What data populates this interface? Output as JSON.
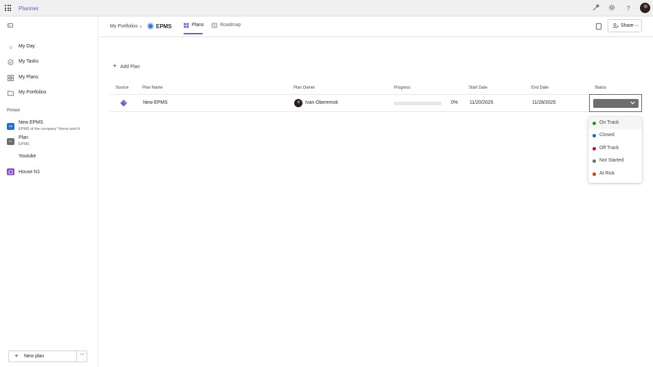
{
  "app": {
    "title": "Planner"
  },
  "topbar": {
    "icons": [
      "app-launcher-icon",
      "diagnostics-icon",
      "gear-icon",
      "help-icon"
    ]
  },
  "sidebar": {
    "nav": [
      {
        "label": "My Day",
        "icon": "sun-icon"
      },
      {
        "label": "My Tasks",
        "icon": "check-circle-icon"
      },
      {
        "label": "My Plans",
        "icon": "grid-icon"
      },
      {
        "label": "My Portfolios",
        "icon": "folder-icon"
      }
    ],
    "pinned_heading": "Pinned",
    "pinned": [
      {
        "title": "New EPMS",
        "subtitle": "EPMS of the company \"Horns and H",
        "badge_color": "#1f6fd1"
      },
      {
        "title": "Plan",
        "subtitle": "EPMS",
        "badge_color": "#6b6b6b"
      },
      {
        "title": "Youtube",
        "subtitle": ""
      },
      {
        "title": "House N1",
        "subtitle": "",
        "badge_color": "#8a4ccc"
      }
    ],
    "new_plan_label": "New plan"
  },
  "header": {
    "breadcrumb": "My Portfolios",
    "portfolio_title": "EPMS",
    "tabs": [
      {
        "label": "Plans",
        "active": true
      },
      {
        "label": "Roadmap",
        "active": false
      }
    ],
    "share_label": "Share"
  },
  "content": {
    "add_plan_label": "Add Plan",
    "columns": [
      "Source",
      "Plan Name",
      "Plan Owner",
      "Progress",
      "Start Date",
      "End Date",
      "Status"
    ],
    "rows": [
      {
        "plan_name": "New EPMS",
        "owner": "Ivan Oberemok",
        "progress": 0,
        "progress_text": "0%",
        "start_date": "11/20/2025",
        "end_date": "11/28/2025"
      }
    ]
  },
  "status_dropdown": {
    "options": [
      {
        "label": "On Track",
        "color": "#13a10e"
      },
      {
        "label": "Closed",
        "color": "#0f6cbd"
      },
      {
        "label": "Off Track",
        "color": "#c50f1f"
      },
      {
        "label": "Not Started",
        "color": "#707070"
      },
      {
        "label": "At Risk",
        "color": "#da3b01"
      }
    ]
  },
  "colors": {
    "accent": "#5b5fc7",
    "topbar_bg": "#f0f0f0"
  }
}
